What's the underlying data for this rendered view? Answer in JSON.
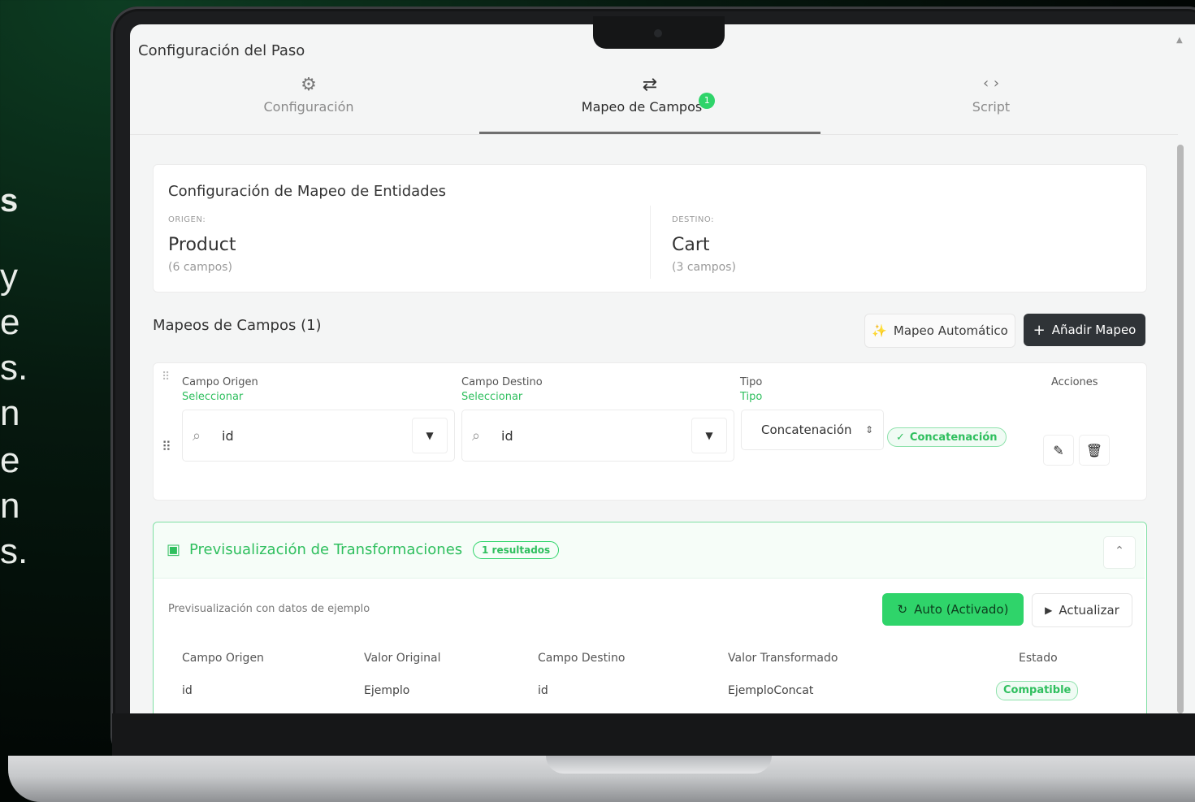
{
  "background_fragments": [
    "s",
    "y",
    "e",
    "s.",
    "n",
    "e",
    "n",
    "s."
  ],
  "dialog": {
    "title": "Configuración del Paso"
  },
  "tabs": [
    {
      "label": "Configuración",
      "icon": "gear-icon"
    },
    {
      "label": "Mapeo de Campos",
      "icon": "swap-arrows-icon",
      "badge": "1",
      "active": true
    },
    {
      "label": "Script",
      "icon": "code-brackets-icon"
    }
  ],
  "entity_mapping": {
    "title": "Configuración de Mapeo de Entidades",
    "origin": {
      "label": "ORIGEN:",
      "entity": "Product",
      "fields": "(6 campos)"
    },
    "destination": {
      "label": "DESTINO:",
      "entity": "Cart",
      "fields": "(3 campos)"
    }
  },
  "field_mappings": {
    "title": "Mapeos de Campos (1)",
    "auto_button": "Mapeo Automático",
    "add_button": "Añadir Mapeo",
    "columns": {
      "origin": {
        "label": "Campo Origen",
        "sub": "Seleccionar"
      },
      "destination": {
        "label": "Campo Destino",
        "sub": "Seleccionar"
      },
      "type": {
        "label": "Tipo",
        "sub": "Tipo"
      },
      "actions": {
        "label": "Acciones"
      }
    },
    "row": {
      "origin_value": "id",
      "destination_value": "id",
      "type_value": "Concatenación",
      "type_chip": "Concatenación"
    }
  },
  "preview": {
    "title": "Previsualización de Transformaciones",
    "count_badge": "1 resultados",
    "subtitle": "Previsualización con datos de ejemplo",
    "auto_button": "Auto (Activado)",
    "refresh_button": "Actualizar",
    "columns": [
      "Campo Origen",
      "Valor Original",
      "Campo Destino",
      "Valor Transformado",
      "Estado"
    ],
    "rows": [
      {
        "origin": "id",
        "original": "Ejemplo",
        "destination": "id",
        "transformed": "EjemploConcat",
        "status": "Compatible"
      }
    ]
  },
  "colors": {
    "accent_green": "#2fd46a",
    "dark_button": "#2f3337"
  }
}
